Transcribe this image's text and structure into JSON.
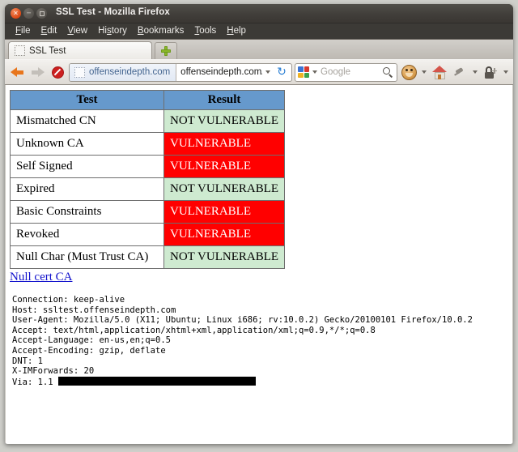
{
  "window": {
    "title": "SSL Test - Mozilla Firefox",
    "close_glyph": "×",
    "minimize_glyph": "−"
  },
  "menubar": {
    "items": [
      {
        "label": "File",
        "accesskey": "F"
      },
      {
        "label": "Edit",
        "accesskey": "E"
      },
      {
        "label": "View",
        "accesskey": "V"
      },
      {
        "label": "History",
        "accesskey": "s"
      },
      {
        "label": "Bookmarks",
        "accesskey": "B"
      },
      {
        "label": "Tools",
        "accesskey": "T"
      },
      {
        "label": "Help",
        "accesskey": "H"
      }
    ]
  },
  "tabs": {
    "active_tab_label": "SSL Test",
    "new_tab_label": "+"
  },
  "toolbar": {
    "back_label": "Back",
    "forward_label": "Forward",
    "stop_label": "Stop",
    "identity_label": "offenseindepth.com",
    "url_value": "offenseindepth.com/",
    "reload_glyph": "↻",
    "search_engine": "Google",
    "search_placeholder": "Google",
    "home_label": "Home",
    "monkey_label": "Firebug",
    "pin_label": "Tamper Data",
    "lock_label": "NoScript"
  },
  "page": {
    "table": {
      "headers": [
        "Test",
        "Result"
      ],
      "rows": [
        {
          "test": "Mismatched CN",
          "result": "NOT VULNERABLE",
          "state": "safe"
        },
        {
          "test": "Unknown CA",
          "result": "VULNERABLE",
          "state": "vuln"
        },
        {
          "test": "Self Signed",
          "result": "VULNERABLE",
          "state": "vuln"
        },
        {
          "test": "Expired",
          "result": "NOT VULNERABLE",
          "state": "safe"
        },
        {
          "test": "Basic Constraints",
          "result": "VULNERABLE",
          "state": "vuln"
        },
        {
          "test": "Revoked",
          "result": "VULNERABLE",
          "state": "vuln"
        },
        {
          "test": "Null Char (Must Trust CA)",
          "result": "NOT VULNERABLE",
          "state": "safe"
        }
      ]
    },
    "link_label": "Null cert CA",
    "headers_text_before": "Connection: keep-alive\nHost: ssltest.offenseindepth.com\nUser-Agent: Mozilla/5.0 (X11; Ubuntu; Linux i686; rv:10.0.2) Gecko/20100101 Firefox/10.0.2\nAccept: text/html,application/xhtml+xml,application/xml;q=0.9,*/*;q=0.8\nAccept-Language: en-us,en;q=0.5\nAccept-Encoding: gzip, deflate\nDNT: 1\nX-IMForwards: 20\nVia: 1.1 ",
    "headers_redacted_note": ""
  },
  "colors": {
    "header_blue": "#6699cc",
    "safe_green": "#ceead0",
    "vulnerable_red": "#ff0000",
    "link_blue": "#1111cc"
  }
}
